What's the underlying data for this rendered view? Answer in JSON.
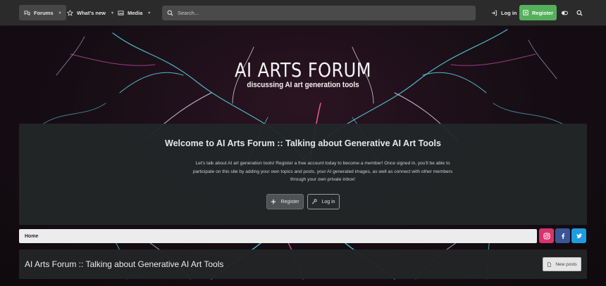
{
  "nav": {
    "tabs": [
      {
        "label": "Forums",
        "icon": "chat-bubbles-icon",
        "active": true
      },
      {
        "label": "What's new",
        "icon": "star-icon"
      },
      {
        "label": "Media",
        "icon": "image-icon"
      }
    ],
    "search_placeholder": "Search...",
    "login_label": "Log in",
    "register_label": "Register",
    "theme_toggle_icon": "toggle-icon",
    "search_icon": "search-icon"
  },
  "hero": {
    "title": "AI ARTS FORUM",
    "subtitle": "discussing AI art generation tools"
  },
  "welcome": {
    "title": "Welcome to AI Arts Forum :: Talking about Generative AI Art Tools",
    "text": "Let's talk about AI art generation tools! Register a free account today to become a member! Once signed in, you'll be able to participate on this site by adding your own topics and posts, your AI generated images, as well as connect with other members through your own private inbox!",
    "register_label": "Register",
    "login_label": "Log in"
  },
  "breadcrumb": {
    "home": "Home"
  },
  "social": {
    "instagram_color": "#d8336d",
    "facebook_color": "#3a5597",
    "twitter_color": "#1d9ce0"
  },
  "page": {
    "title": "AI Arts Forum :: Talking about Generative AI Art Tools",
    "new_posts_label": "New posts"
  },
  "colors": {
    "accent_green": "#55b05c",
    "nav_bg": "#2b2b2b"
  }
}
